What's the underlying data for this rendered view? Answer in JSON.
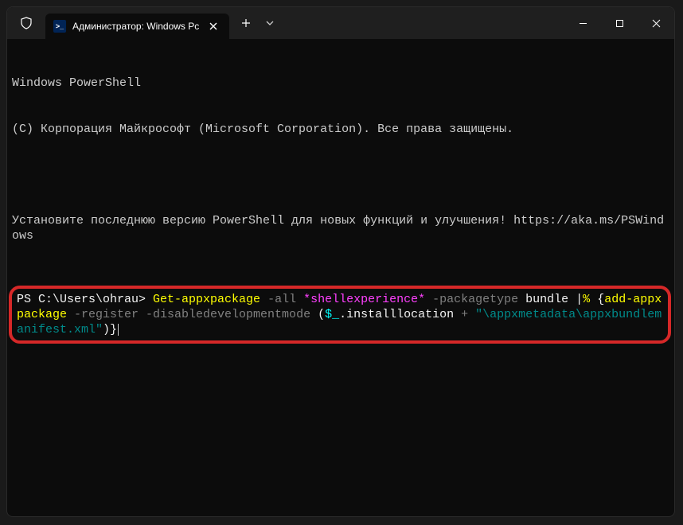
{
  "titlebar": {
    "tab_title": "Администратор: Windows Pc",
    "ps_icon_text": ">_"
  },
  "terminal": {
    "header_line1": "Windows PowerShell",
    "header_line2": "(C) Корпорация Майкрософт (Microsoft Corporation). Все права защищены.",
    "notice": "Установите последнюю версию PowerShell для новых функций и улучшения! https://aka.ms/PSWindows",
    "prompt": "PS C:\\Users\\ohrau> ",
    "cmd": {
      "p1_yellow": "Get-appxpackage",
      "p2_gray": " -all ",
      "p3_magenta": "*shellexperience*",
      "p4_gray": " -packagetype ",
      "p5_white": "bundle ",
      "p6a_white": "|",
      "p6b_yellow": "% ",
      "p7_white": "{",
      "p8_yellow": "add-appxpackage",
      "p9_gray": " -register -disabledevelopmentmode ",
      "p10_white": "(",
      "p11_cyan": "$_",
      "p12_white": ".installlocation ",
      "p13_gray": "+ ",
      "p14_darkcyan": "\"\\appxmetadata\\appxbundlemanifest.xml\"",
      "p15_white": ")}"
    }
  }
}
